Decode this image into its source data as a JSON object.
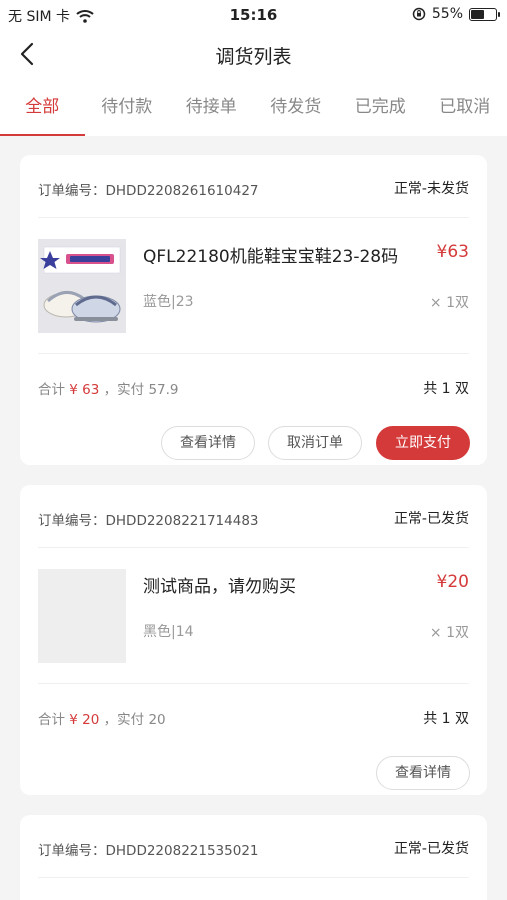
{
  "status_bar": {
    "carrier": "无 SIM 卡",
    "time": "15:16",
    "battery_percent": "55%",
    "battery_level": 0.55
  },
  "nav": {
    "title": "调货列表"
  },
  "tabs": [
    {
      "label": "全部",
      "active": true
    },
    {
      "label": "待付款",
      "active": false
    },
    {
      "label": "待接单",
      "active": false
    },
    {
      "label": "待发货",
      "active": false
    },
    {
      "label": "已完成",
      "active": false
    },
    {
      "label": "已取消",
      "active": false
    }
  ],
  "orders": [
    {
      "order_no": "订单编号：DHDD2208261610427",
      "status": "正常-未发货",
      "product_name": "QFL22180机能鞋宝宝鞋23-28码",
      "price": "¥63",
      "spec": "蓝色|23",
      "qty": "× 1双",
      "total_label": "合计",
      "total_value": "¥ 63",
      "paid_label": "，实付",
      "paid_value": "57.9",
      "count": "共 1 双",
      "buttons": {
        "details": "查看详情",
        "cancel": "取消订单",
        "pay": "立即支付"
      }
    },
    {
      "order_no": "订单编号：DHDD2208221714483",
      "status": "正常-已发货",
      "product_name": "测试商品，请勿购买",
      "price": "¥20",
      "spec": "黑色|14",
      "qty": "× 1双",
      "total_label": "合计",
      "total_value": "¥ 20",
      "paid_label": "，实付",
      "paid_value": "20",
      "count": "共 1 双",
      "buttons": {
        "details": "查看详情"
      }
    },
    {
      "order_no": "订单编号：DHDD2208221535021",
      "status": "正常-已发货"
    }
  ],
  "colors": {
    "accent": "#d43a3a",
    "background": "#f4f4f4"
  },
  "icons": {
    "back": "chevron-left-icon",
    "wifi": "wifi-icon",
    "orientation_lock": "orientation-lock-icon",
    "battery": "battery-icon"
  }
}
